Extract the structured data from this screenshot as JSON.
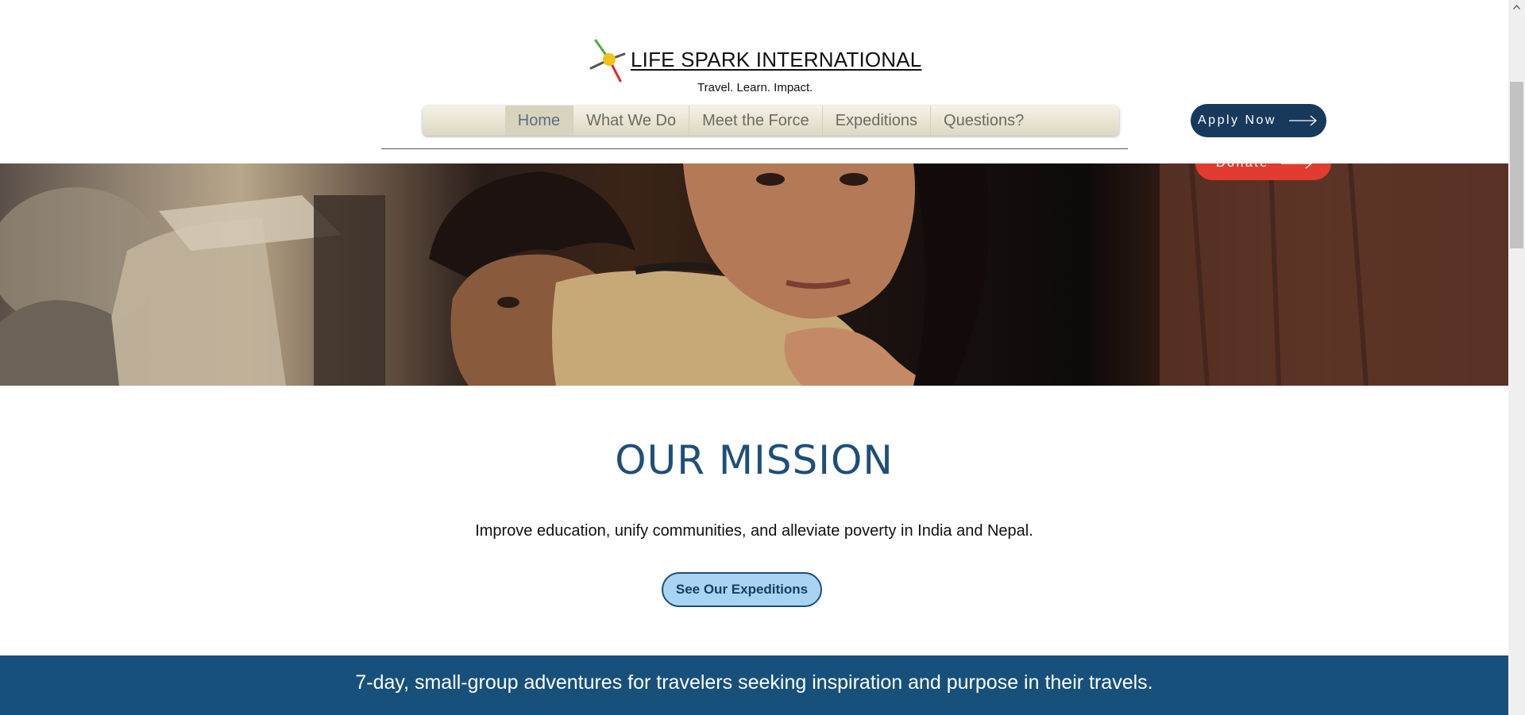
{
  "header": {
    "logo_title": "LIFE SPARK INTERNATIONAL",
    "tagline": "Travel. Learn. Impact.",
    "apply_label": "Apply Now"
  },
  "nav": {
    "items": [
      {
        "label": "Home",
        "active": true
      },
      {
        "label": "What We Do"
      },
      {
        "label": "Meet the Force"
      },
      {
        "label": "Expeditions"
      },
      {
        "label": "Questions?"
      }
    ]
  },
  "hero": {
    "donate_label": "Donate"
  },
  "mission": {
    "title": "OUR MISSION",
    "text": "Improve education, unify communities, and alleviate poverty in India and Nepal.",
    "button_label": "See Our Expeditions"
  },
  "banner": {
    "text": "7-day, small-group adventures for travelers seeking inspiration and purpose in their travels."
  },
  "colors": {
    "navy": "#17395c",
    "mission_blue": "#1d4f7a",
    "banner_blue": "#17507a",
    "donate_red": "#e23b2f",
    "expeditions_button": "#a9d3f2"
  },
  "icons": {
    "logo_mark": "four-point-spark-logo-icon",
    "button_arrow": "long-arrow-right-icon"
  }
}
